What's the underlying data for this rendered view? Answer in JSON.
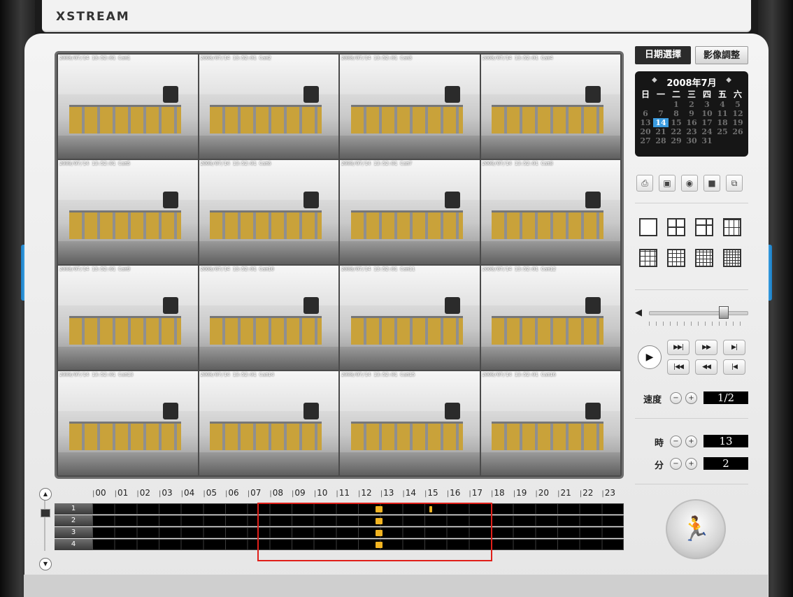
{
  "app": {
    "brand": "XSTREAM"
  },
  "cameras": [
    {
      "timestamp": "2008/07/14 13:52:01 Cam1"
    },
    {
      "timestamp": "2008/07/14 13:52:01 Cam2"
    },
    {
      "timestamp": "2008/07/14 13:52:01 Cam3"
    },
    {
      "timestamp": "2008/07/14 13:52:01 Cam4"
    },
    {
      "timestamp": "2008/07/14 13:52:01 Cam5"
    },
    {
      "timestamp": "2008/07/14 13:52:01 Cam6"
    },
    {
      "timestamp": "2008/07/14 13:52:01 Cam7"
    },
    {
      "timestamp": "2008/07/14 13:52:01 Cam8"
    },
    {
      "timestamp": "2008/07/14 13:52:01 Cam9"
    },
    {
      "timestamp": "2008/07/14 13:52:01 Cam10"
    },
    {
      "timestamp": "2008/07/14 13:52:01 Cam11"
    },
    {
      "timestamp": "2008/07/14 13:52:01 Cam12"
    },
    {
      "timestamp": "2008/07/14 13:52:01 Cam13"
    },
    {
      "timestamp": "2008/07/14 13:52:01 Cam14"
    },
    {
      "timestamp": "2008/07/14 13:52:01 Cam15"
    },
    {
      "timestamp": "2008/07/14 13:52:01 Cam16"
    }
  ],
  "tabs": {
    "date": "日期選擇",
    "image": "影像調整"
  },
  "calendar": {
    "title": "2008年7月",
    "prev": "◆",
    "next": "◆",
    "weekdays": [
      "日",
      "一",
      "二",
      "三",
      "四",
      "五",
      "六"
    ],
    "weeks": [
      [
        "",
        "",
        "1",
        "2",
        "3",
        "4",
        "5"
      ],
      [
        "6",
        "7",
        "8",
        "9",
        "10",
        "11",
        "12"
      ],
      [
        "13",
        "14",
        "15",
        "16",
        "17",
        "18",
        "19"
      ],
      [
        "20",
        "21",
        "22",
        "23",
        "24",
        "25",
        "26"
      ],
      [
        "27",
        "28",
        "29",
        "30",
        "31",
        "",
        ""
      ]
    ],
    "selected_day": "14"
  },
  "timeline": {
    "hours": [
      "00",
      "01",
      "02",
      "03",
      "04",
      "05",
      "06",
      "07",
      "08",
      "09",
      "10",
      "11",
      "12",
      "13",
      "14",
      "15",
      "16",
      "17",
      "18",
      "19",
      "20",
      "21",
      "22",
      "23"
    ],
    "channels": [
      {
        "label": "1",
        "records": [
          12.75,
          15.2
        ]
      },
      {
        "label": "2",
        "records": [
          12.75
        ]
      },
      {
        "label": "3",
        "records": [
          12.75
        ]
      },
      {
        "label": "4",
        "records": [
          12.75
        ]
      }
    ],
    "highlight_color": "#e0201a",
    "record_color": "#f2b421"
  },
  "controls": {
    "speed_label": "速度",
    "speed_value": "1/2",
    "hour_label": "時",
    "hour_value": "13",
    "minute_label": "分",
    "minute_value": "2",
    "minus": "−",
    "plus": "+"
  },
  "accent_color": "#3a9be0"
}
